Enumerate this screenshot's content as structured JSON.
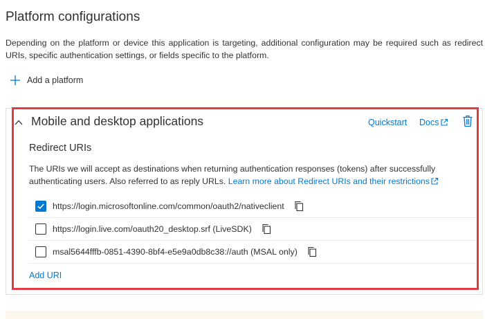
{
  "page": {
    "title": "Platform configurations",
    "description": "Depending on the platform or device this application is targeting, additional configuration may be required such as redirect URIs, specific authentication settings, or fields specific to the platform.",
    "add_platform_label": "Add a platform"
  },
  "platform_card": {
    "title": "Mobile and desktop applications",
    "quickstart_label": "Quickstart",
    "docs_label": "Docs",
    "redirect_section": {
      "title": "Redirect URIs",
      "info_text": "The URIs we will accept as destinations when returning authentication responses (tokens) after successfully authenticating users. Also referred to as reply URLs. ",
      "learn_more_label": "Learn more about Redirect URIs and their restrictions",
      "uris": [
        {
          "value": "https://login.microsoftonline.com/common/oauth2/nativeclient",
          "checked": true
        },
        {
          "value": "https://login.live.com/oauth20_desktop.srf (LiveSDK)",
          "checked": false
        },
        {
          "value": "msal5644fffb-0851-4390-8bf4-e5e9a0db8c38://auth (MSAL only)",
          "checked": false
        }
      ],
      "add_uri_label": "Add URI"
    }
  },
  "colors": {
    "link": "#0078d4",
    "highlight_border": "#e03c46",
    "checkbox_checked": "#0078d4",
    "text": "#323130"
  },
  "icons": {
    "add": "plus-icon",
    "collapse": "chevron-up-icon",
    "external": "external-link-icon",
    "delete": "trash-icon",
    "copy": "copy-icon",
    "check": "checkmark-icon"
  }
}
